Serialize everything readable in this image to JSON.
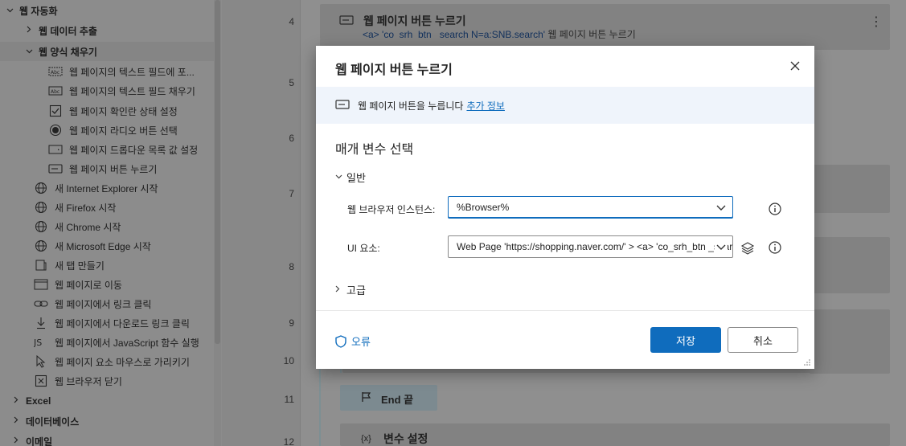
{
  "sidebar": {
    "rows": [
      {
        "label": "웹 자동화",
        "chev": "⌄",
        "icon": "",
        "level": 0
      },
      {
        "label": "웹 데이터 추출",
        "chev": "›",
        "icon": "",
        "level": 1
      },
      {
        "label": "웹 양식 채우기",
        "chev": "⌄",
        "icon": "",
        "level": 1
      },
      {
        "label": "웹 페이지의 텍스트 필드에 포...",
        "icon": "text-field-focus-icon",
        "level": 2
      },
      {
        "label": "웹 페이지의 텍스트 필드 채우기",
        "icon": "text-field-fill-icon",
        "level": 2
      },
      {
        "label": "웹 페이지 확인란 상태 설정",
        "icon": "checkbox-icon",
        "level": 2
      },
      {
        "label": "웹 페이지 라디오 버튼 선택",
        "icon": "radio-button-icon",
        "level": 2
      },
      {
        "label": "웹 페이지 드롭다운 목록 값 설정",
        "icon": "dropdown-icon",
        "level": 2
      },
      {
        "label": "웹 페이지 버튼 누르기",
        "icon": "button-icon",
        "level": 2
      },
      {
        "label": "새 Internet Explorer 시작",
        "icon": "globe-icon",
        "level": 1
      },
      {
        "label": "새 Firefox 시작",
        "icon": "globe-icon",
        "level": 1
      },
      {
        "label": "새 Chrome 시작",
        "icon": "globe-icon",
        "level": 1
      },
      {
        "label": "새 Microsoft Edge 시작",
        "icon": "globe-icon",
        "level": 1
      },
      {
        "label": "새 탭 만들기",
        "icon": "new-tab-icon",
        "level": 1
      },
      {
        "label": "웹 페이지로 이동",
        "icon": "browser-window-icon",
        "level": 1
      },
      {
        "label": "웹 페이지에서 링크 클릭",
        "icon": "link-icon",
        "level": 1
      },
      {
        "label": "웹 페이지에서 다운로드 링크 클릭",
        "icon": "download-icon",
        "level": 1
      },
      {
        "label": "웹 페이지에서 JavaScript 함수 실행",
        "icon": "js-icon",
        "level": 1
      },
      {
        "label": "웹 페이지 요소 마우스로 가리키기",
        "icon": "pointer-icon",
        "level": 1
      },
      {
        "label": "웹 브라우저 닫기",
        "icon": "close-box-icon",
        "level": 1
      },
      {
        "label": "Excel",
        "chev": "›",
        "icon": "",
        "level": 0
      },
      {
        "label": "데이터베이스",
        "chev": "›",
        "icon": "",
        "level": 0
      },
      {
        "label": "이메일",
        "chev": "›",
        "icon": "",
        "level": 0
      }
    ]
  },
  "flow": {
    "line_numbers": [
      "4",
      "5",
      "6",
      "7",
      "8",
      "9",
      "10",
      "11",
      "12"
    ],
    "top_action": {
      "title": "웹 페이지 버튼 누르기",
      "desc_token": "<a> 'co_srh_btn _search N=a:SNB.search'",
      "desc_rest": " 웹 페이지 버튼 누르기"
    },
    "end_label": "End 끝",
    "var_title": "변수 설정",
    "var_icon_text": "{x}",
    "more_icon": "⋮"
  },
  "modal": {
    "title": "웹 페이지 버튼 누르기",
    "info_text": "웹 페이지 버튼을 누릅니다",
    "info_link": "추가 정보",
    "param_heading": "매개 변수 선택",
    "general_label": "일반",
    "browser_label": "웹 브라우저 인스턴스:",
    "browser_value": "%Browser%",
    "ui_label": "UI 요소:",
    "ui_value": "Web Page 'https://shopping.naver.com/' > <a> 'co_srh_btn _search N=a:SNB.search'",
    "advanced_label": "고급",
    "error_label": "오류",
    "save_label": "저장",
    "cancel_label": "취소"
  },
  "colors": {
    "accent": "#0f6cbd",
    "overlay": "#8f8f8f"
  }
}
